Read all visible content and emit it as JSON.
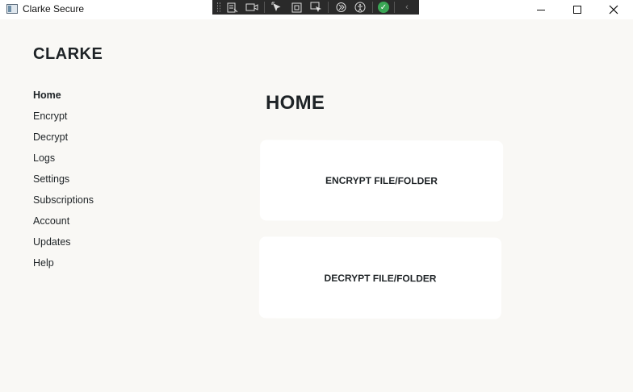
{
  "window": {
    "title": "Clarke Secure",
    "controls": [
      "minimize",
      "maximize",
      "close"
    ]
  },
  "debug_toolbar": {
    "icons": [
      "live-visual-tree-icon",
      "select-element-icon",
      "display-layout-adorners-icon",
      "track-focus-icon",
      "hot-reload-icon",
      "accessibility-icon",
      "status-ok-icon",
      "collapse-icon"
    ]
  },
  "sidebar": {
    "brand": "CLARKE",
    "items": [
      {
        "label": "Home",
        "active": true
      },
      {
        "label": "Encrypt"
      },
      {
        "label": "Decrypt"
      },
      {
        "label": "Logs"
      },
      {
        "label": "Settings"
      },
      {
        "label": "Subscriptions"
      },
      {
        "label": "Account"
      },
      {
        "label": "Updates"
      },
      {
        "label": "Help"
      }
    ]
  },
  "main": {
    "title": "HOME",
    "cards": [
      {
        "label": "ENCRYPT FILE/FOLDER"
      },
      {
        "label": "DECRYPT FILE/FOLDER"
      }
    ]
  },
  "colors": {
    "background": "#f9f8f5",
    "card": "#ffffff",
    "text": "#1e2326"
  }
}
